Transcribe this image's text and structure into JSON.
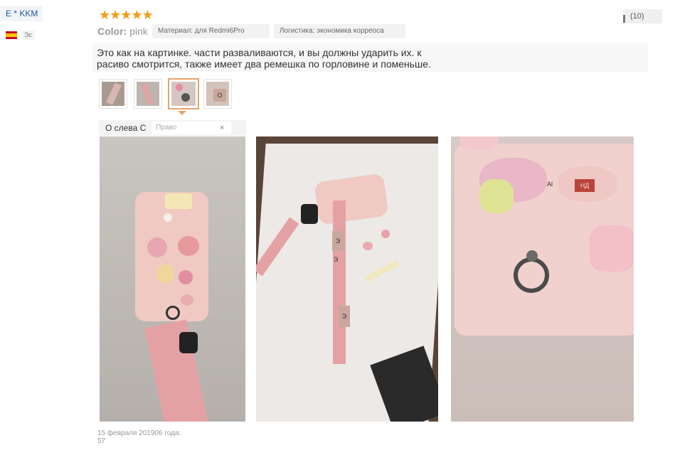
{
  "user": {
    "name": "E * KKM",
    "country_code": "Эс"
  },
  "rating": {
    "stars": "★★★★★"
  },
  "helpful": {
    "count": "(10)"
  },
  "meta": {
    "color_label": "Color:",
    "color_value": "pink",
    "material": "Материал: для Redmi6Pro",
    "logistics": "Логистика: экономика корреоса"
  },
  "review": {
    "text_line1": "Это как на картинке. части разваливаются, и вы должны ударить их. к",
    "text_line2": "расиво смотрится, также имеет два ремешка по горловине и поменьше."
  },
  "thumbnails": {
    "t4_label": "О"
  },
  "rotate": {
    "left_label": "О слева С",
    "right_label": "Право",
    "close": "×"
  },
  "photos": {
    "p2_tag1": "Э",
    "p2_tag2": "Э",
    "p2_tag3": "Э",
    "p3_tag1": "Al",
    "p3_tag2": "НД"
  },
  "footer": {
    "date": "15 февраля 201906 года:",
    "count": "57"
  },
  "colors": {
    "star": "#f49a15",
    "accent": "#e8a36a",
    "link": "#1b57a7"
  }
}
